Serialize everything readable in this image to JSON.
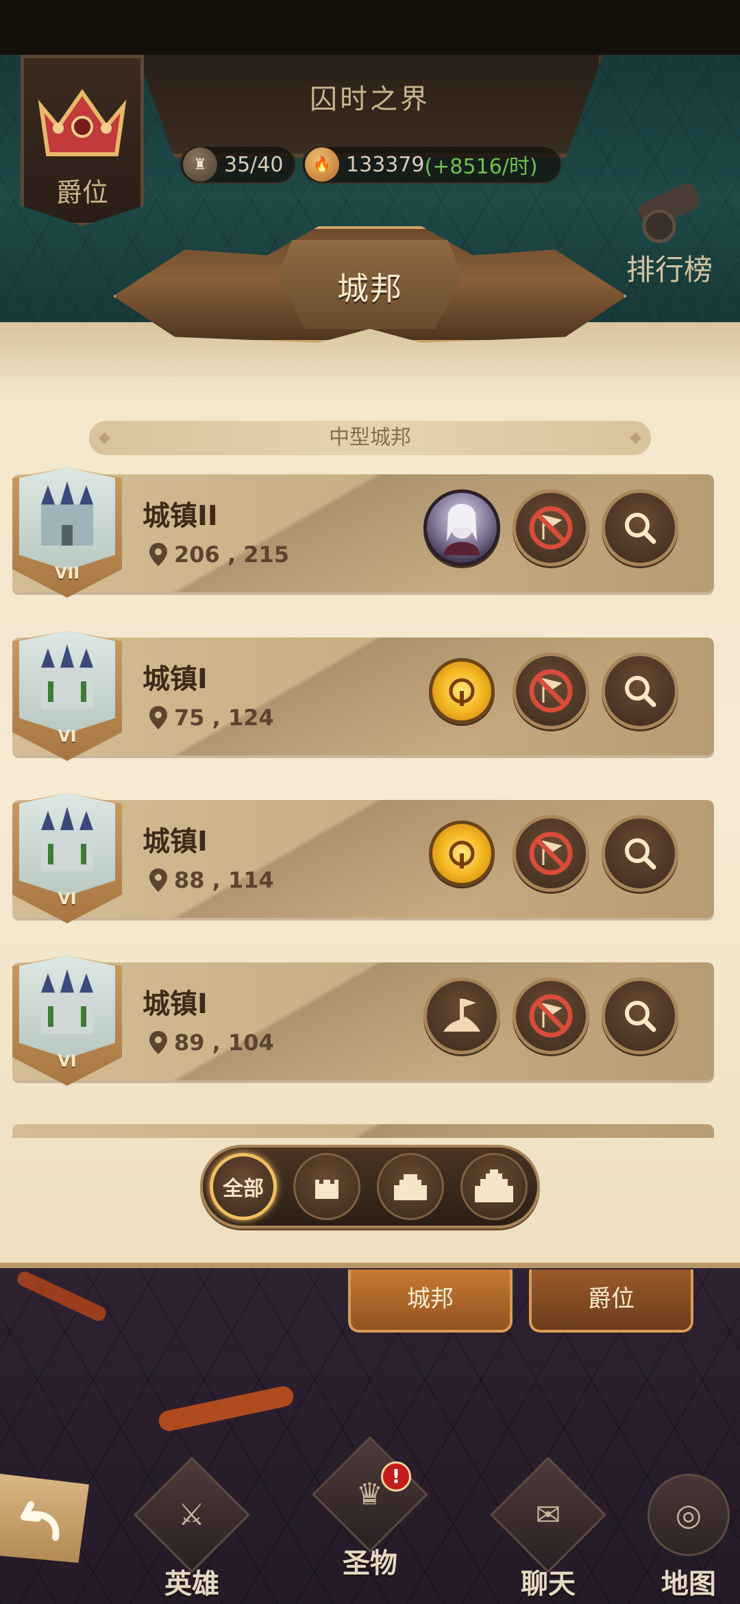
{
  "header": {
    "world_title": "囚时之界",
    "rank_label": "爵位",
    "ranking_label": "排行榜",
    "resources": {
      "troops": "35/40",
      "fire_amount": "133379",
      "fire_rate": "(+8516/时)"
    }
  },
  "panel": {
    "title": "城邦",
    "section_title": "中型城邦"
  },
  "cities": [
    {
      "name": "城镇II",
      "coords": "206 , 215",
      "level": "VII",
      "occupant": "hero-portrait"
    },
    {
      "name": "城镇I",
      "coords": "75 , 124",
      "level": "VI",
      "occupant": "sun-emblem"
    },
    {
      "name": "城镇I",
      "coords": "88 , 114",
      "level": "VI",
      "occupant": "sun-emblem"
    },
    {
      "name": "城镇I",
      "coords": "89 , 104",
      "level": "VI",
      "occupant": "hand-on-hill"
    }
  ],
  "filters": {
    "all_label": "全部",
    "active": "all"
  },
  "tabs": {
    "city": "城邦",
    "rank": "爵位",
    "active": "city"
  },
  "nav": {
    "hero": "英雄",
    "relic": "圣物",
    "chat": "聊天",
    "map": "地图",
    "relic_alert": "!"
  },
  "colors": {
    "parchment": "#f5ead2",
    "wood": "#6a4b33",
    "gold_accent": "#f0c060",
    "tab_active": "#c77b34",
    "resource_gain": "#6fc24a"
  }
}
